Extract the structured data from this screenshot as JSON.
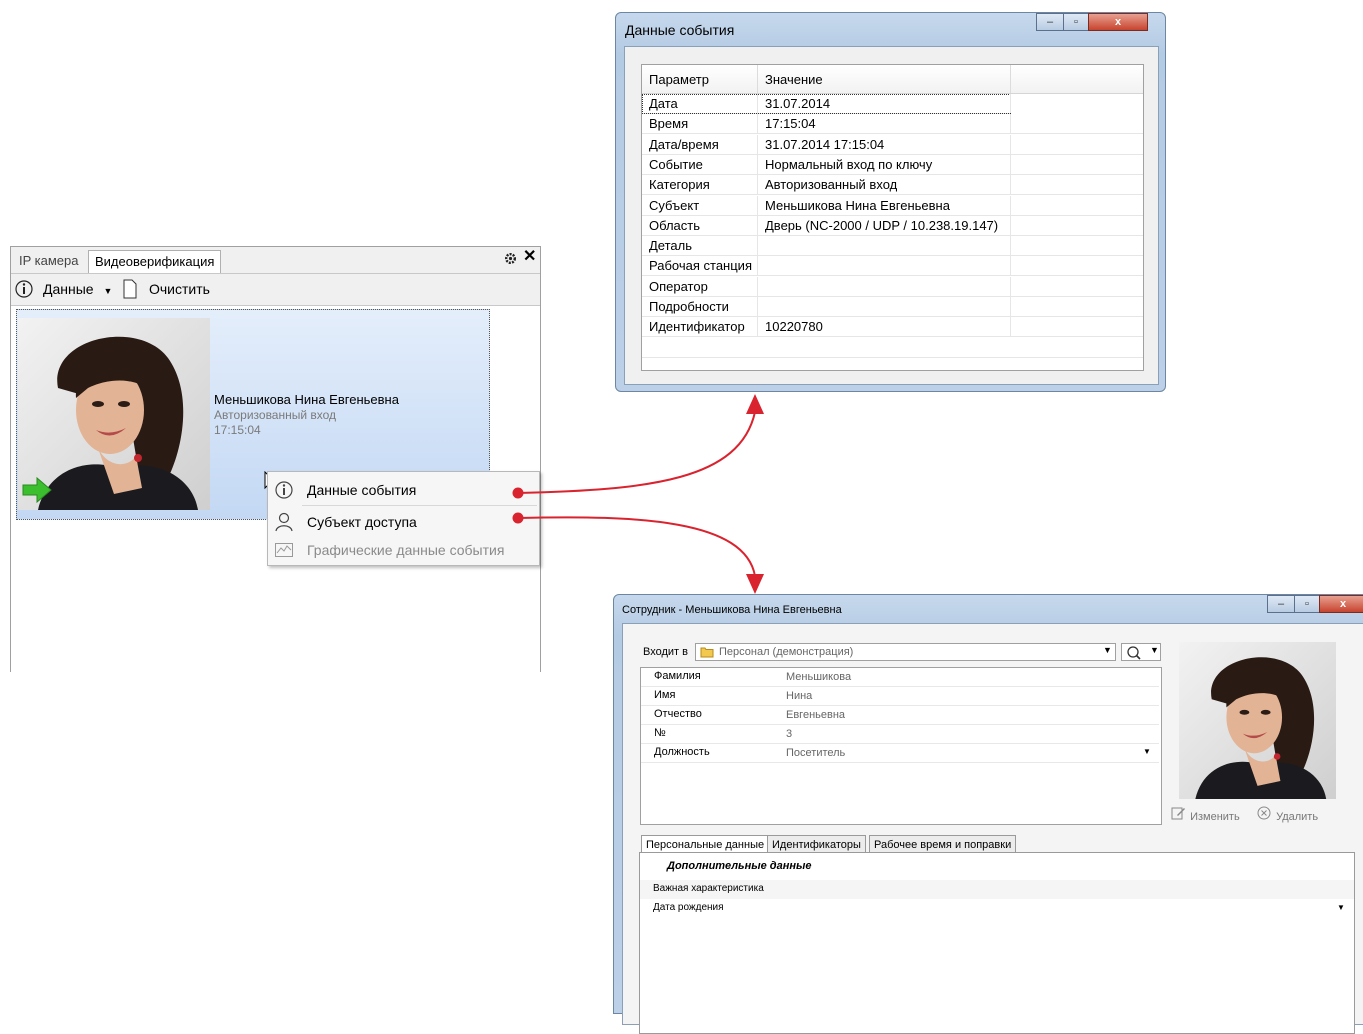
{
  "video_panel": {
    "tabs": [
      {
        "label": "IP камера"
      },
      {
        "label": "Видеоверификация"
      }
    ],
    "settings_icon": "gear-icon",
    "close_symbol": "✕",
    "toolbar": {
      "data_label": "Данные",
      "clear_label": "Очистить"
    },
    "event": {
      "name": "Меньшикова Нина Евгеньевна",
      "category": "Авторизованный вход",
      "time": "17:15:04"
    }
  },
  "context_menu": {
    "items": [
      {
        "label": "Данные события",
        "icon": "info-icon",
        "enabled": true
      },
      {
        "label": "Субъект доступа",
        "icon": "person-icon",
        "enabled": true
      },
      {
        "label": "Графические данные события",
        "icon": "chart-icon",
        "enabled": false
      }
    ]
  },
  "event_window": {
    "title": "Данные события",
    "columns": [
      "Параметр",
      "Значение"
    ],
    "rows": [
      {
        "param": "Дата",
        "value": "31.07.2014"
      },
      {
        "param": "Время",
        "value": "17:15:04"
      },
      {
        "param": "Дата/время",
        "value": "31.07.2014 17:15:04"
      },
      {
        "param": "Событие",
        "value": "Нормальный вход по ключу"
      },
      {
        "param": "Категория",
        "value": "Авторизованный вход"
      },
      {
        "param": "Субъект",
        "value": "Меньшикова Нина Евгеньевна"
      },
      {
        "param": "Область",
        "value": "Дверь (NC-2000 / UDP / 10.238.19.147)"
      },
      {
        "param": "Деталь",
        "value": ""
      },
      {
        "param": "Рабочая станция",
        "value": ""
      },
      {
        "param": "Оператор",
        "value": ""
      },
      {
        "param": "Подробности",
        "value": ""
      },
      {
        "param": "Идентификатор",
        "value": "10220780"
      }
    ]
  },
  "employee_window": {
    "title": "Сотрудник - Меньшикова Нина Евгеньевна",
    "group_label": "Входит в",
    "group_value": "Персонал (демонстрация)",
    "fields": [
      {
        "label": "Фамилия",
        "value": "Меньшикова"
      },
      {
        "label": "Имя",
        "value": "Нина"
      },
      {
        "label": "Отчество",
        "value": "Евгеньевна"
      },
      {
        "label": "№",
        "value": "3"
      },
      {
        "label": "Должность",
        "value": "Посетитель"
      }
    ],
    "photo_actions": {
      "edit": "Изменить",
      "delete": "Удалить"
    },
    "tabs": [
      {
        "label": "Персональные данные"
      },
      {
        "label": "Идентификаторы"
      },
      {
        "label": "Рабочее время и поправки"
      }
    ],
    "section_title": "Дополнительные данные",
    "extra_fields": [
      {
        "label": "Важная характеристика"
      },
      {
        "label": "Дата рождения"
      }
    ]
  },
  "colors": {
    "arrow": "#d9232e",
    "selection_top": "#e4eefb",
    "selection_bottom": "#c3d8f4",
    "entry_arrow": "#3cbf2f"
  }
}
